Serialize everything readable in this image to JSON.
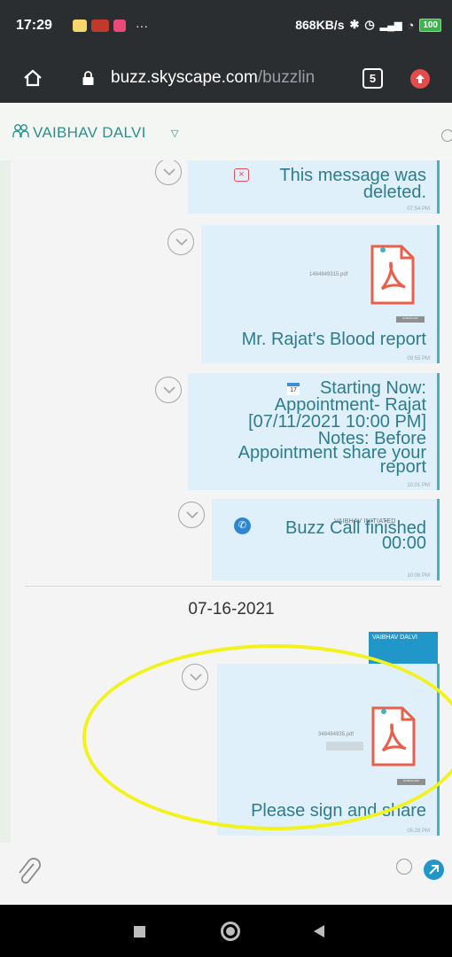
{
  "status_bar": {
    "time": "17:29",
    "ellipsis": "···",
    "net_speed": "868KB/s",
    "battery": "100",
    "colors": {
      "bg": "#2a2e31",
      "battery": "#39b54a"
    }
  },
  "browser": {
    "url_host": "buzz.skyscape.com",
    "url_path": "/buzzlin",
    "tab_count": "5"
  },
  "chat": {
    "contact_name": "VAIBHAV DALVI",
    "messages": [
      {
        "type": "deleted",
        "text": "This message was deleted.",
        "time": "07:54 PM"
      },
      {
        "type": "file",
        "filename": "1484849315.pdf",
        "caption": "Mr. Rajat's Blood report",
        "time": "09:55 PM",
        "tag": "DOWNLOAD"
      },
      {
        "type": "appointment",
        "line1": "Starting Now:",
        "line2": "Appointment- Rajat",
        "line3": "[07/11/2021 10:00 PM]",
        "line4": "Notes: Before",
        "line5": "Appointment share your",
        "line6": "report",
        "time": "10:01 PM"
      },
      {
        "type": "call",
        "initiator": "VAIBHAV INITIATED",
        "text": "Buzz Call finished",
        "duration": "00:00",
        "time": "10:06 PM"
      }
    ],
    "date_separator": "07-16-2021",
    "sender_tag": "VAIBHAV DALVI",
    "last_message": {
      "type": "file",
      "filename": "348484935.pdf",
      "caption": "Please sign and share",
      "time": "05:28 PM",
      "tag": "DOWNLOAD"
    }
  },
  "colors": {
    "accent": "#2d8f8b",
    "bubble": "#dff0fa",
    "bubble_border": "#48b1c0",
    "pdf_red": "#e8604c",
    "annotation": "#f2f21c",
    "send": "#2196c8"
  }
}
